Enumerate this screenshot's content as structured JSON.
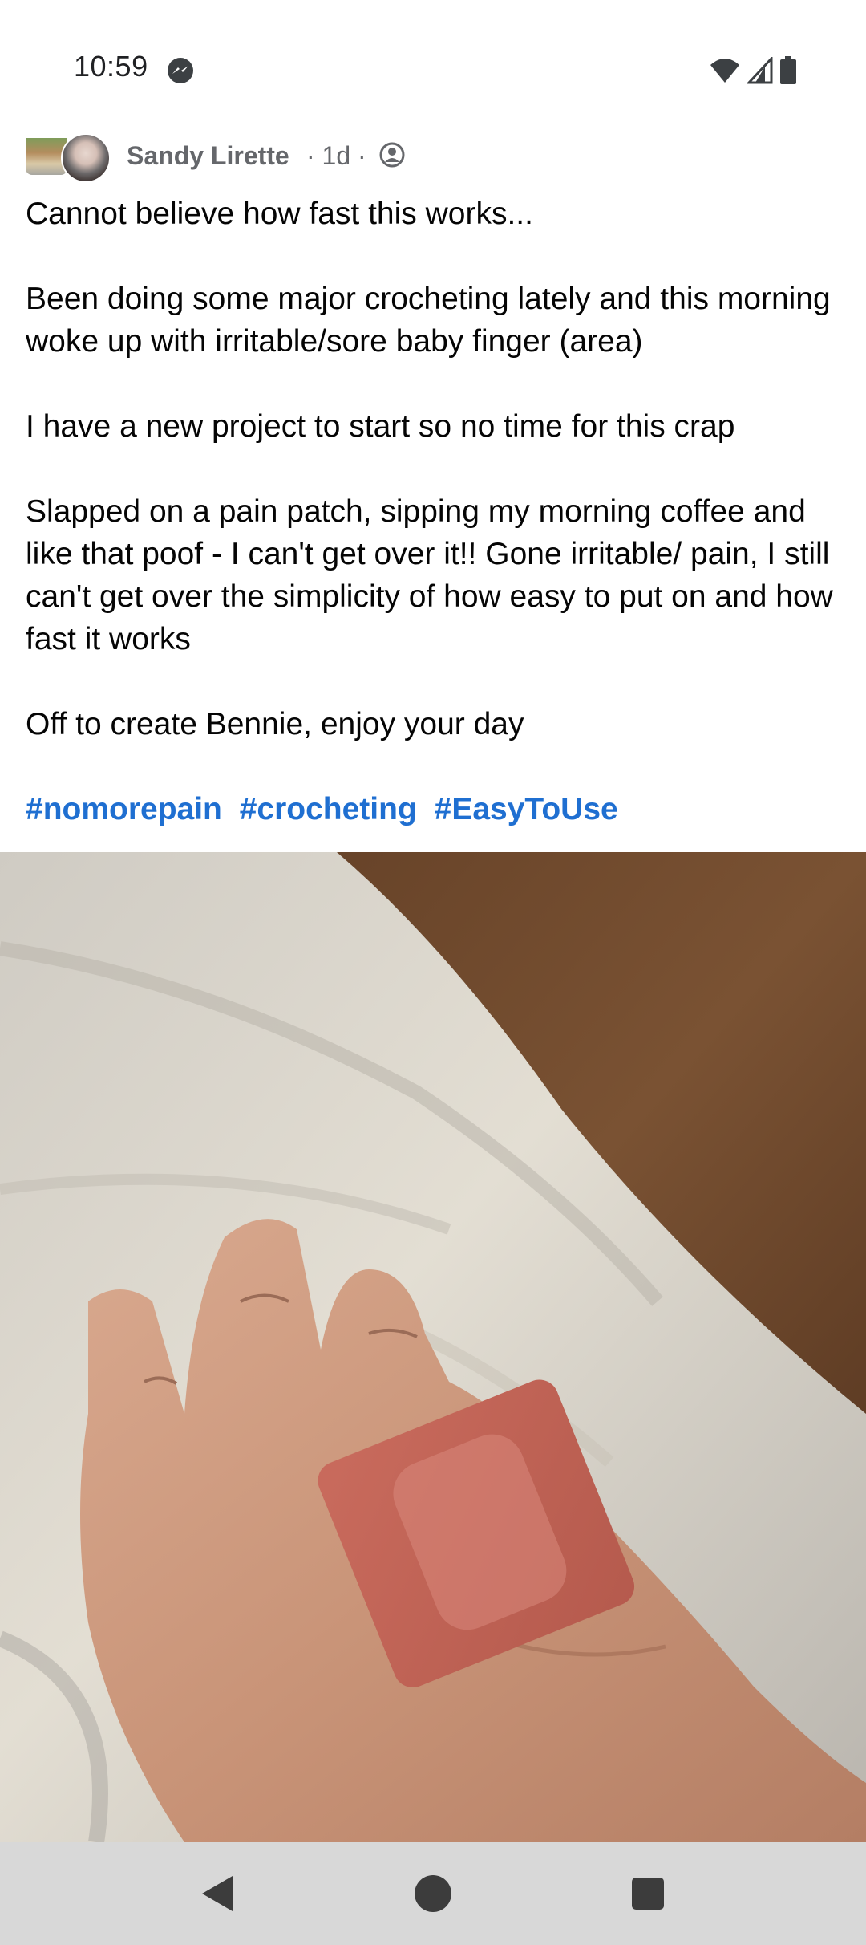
{
  "status_bar": {
    "time": "10:59",
    "notification_icon": "messenger-icon",
    "icons": [
      "wifi-icon",
      "cell-signal-icon",
      "battery-icon"
    ]
  },
  "post": {
    "author": "Sandy Lirette",
    "meta": "· 1d ·",
    "privacy_icon": "friends-privacy-icon",
    "paragraphs": [
      "Cannot believe how fast this works...",
      "Been doing some major crocheting lately and this morning woke up with irritable/sore baby finger (area)",
      "I have a new project to start so no time for this crap",
      "Slapped on a pain patch, sipping my morning coffee and like that poof - I can't get over it!!  Gone irritable/ pain, I still can't get over the simplicity of how easy to put on and how fast it works",
      "Off to create Bennie, enjoy your day"
    ],
    "hashtags": [
      "#nomorepain",
      "#crocheting",
      "#EasyToUse"
    ],
    "hashtag_color": "#1f6fd1"
  },
  "nav_bar": {
    "buttons": [
      "back-icon",
      "home-icon",
      "recents-icon"
    ],
    "background": "#d8d8d8"
  }
}
